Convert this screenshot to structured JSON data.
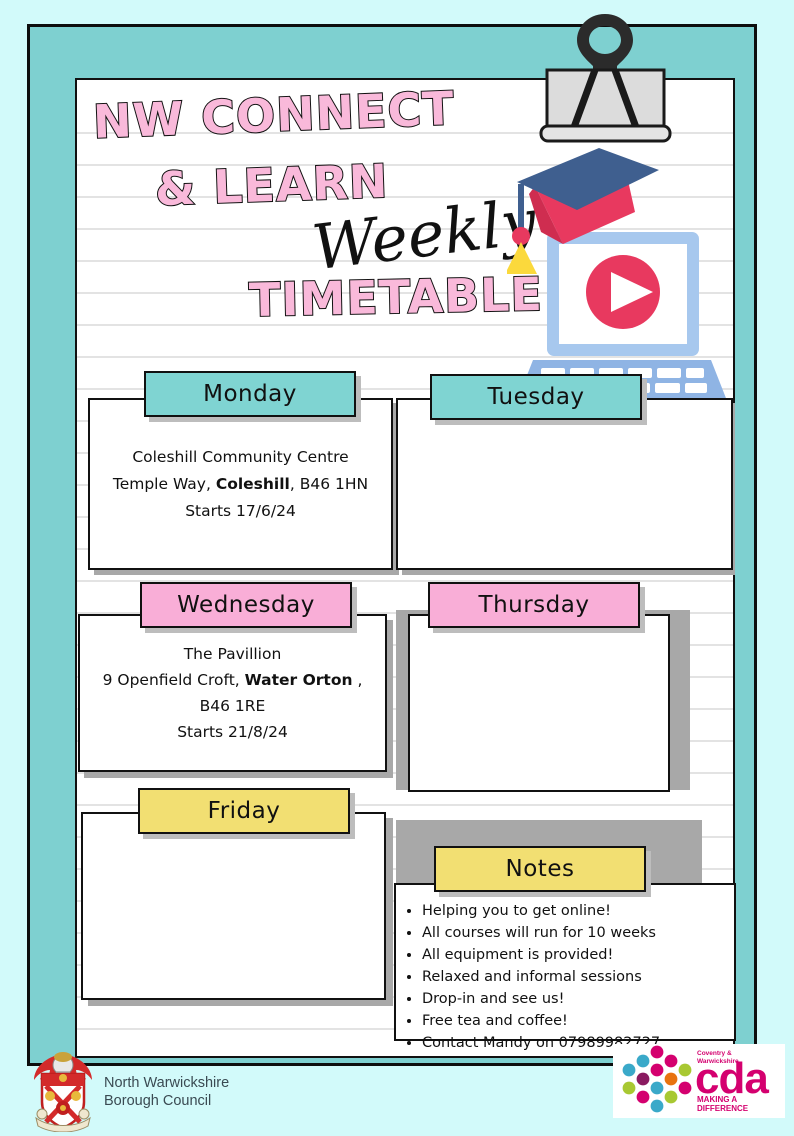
{
  "poster": {
    "title_line1": "NW CONNECT",
    "title_line2": "& LEARN",
    "title_script": "Weekly",
    "title_line3": "TIMETABLE"
  },
  "colors": {
    "page_background": "#d2fafa",
    "frame_teal": "#7ed0d0",
    "header_teal": "#7fd4d2",
    "header_pink": "#f9aed7",
    "header_yellow": "#f2df72",
    "title_pink": "#f9b9da",
    "shadow_gray": "#a8a8a8",
    "accent_crimson": "#e8395f",
    "laptop_blue": "#a7c8ee",
    "cap_navy": "#3f5f8f",
    "cda_magenta": "#d4006f"
  },
  "days": [
    {
      "id": "monday",
      "label": "Monday",
      "color": "teal",
      "lines": [
        {
          "text": "Coleshill Community Centre",
          "bold": ""
        },
        {
          "pre": "Temple Way, ",
          "bold": "Coleshill",
          "post": ", B46 1HN"
        },
        {
          "text": "Starts 17/6/24",
          "bold": ""
        }
      ]
    },
    {
      "id": "tuesday",
      "label": "Tuesday",
      "color": "teal",
      "lines": []
    },
    {
      "id": "wednesday",
      "label": "Wednesday",
      "color": "pink",
      "lines": [
        {
          "text": "The Pavillion",
          "bold": ""
        },
        {
          "pre": "9 Openfield Croft, ",
          "bold": "Water Orton",
          "post": " ,"
        },
        {
          "text": "B46 1RE",
          "bold": ""
        },
        {
          "text": "Starts 21/8/24",
          "bold": ""
        }
      ]
    },
    {
      "id": "thursday",
      "label": "Thursday",
      "color": "pink",
      "lines": []
    },
    {
      "id": "friday",
      "label": "Friday",
      "color": "yellow",
      "lines": []
    }
  ],
  "monday_line1": "Coleshill Community Centre",
  "monday_line2_pre": "Temple Way, ",
  "monday_line2_bold": "Coleshill",
  "monday_line2_post": ", B46 1HN",
  "monday_line3": "Starts 17/6/24",
  "wednesday_line1": "The Pavillion",
  "wednesday_line2_pre": "9 Openfield Croft, ",
  "wednesday_line2_bold": "Water Orton",
  "wednesday_line2_post": " ,",
  "wednesday_line3": "B46 1RE",
  "wednesday_line4": "Starts 21/8/24",
  "notes": {
    "label": "Notes",
    "items": [
      "Helping you to get online!",
      "All courses will run for 10 weeks",
      "All equipment is provided!",
      "Relaxed and informal sessions",
      "Drop-in and see us!",
      "Free tea and coffee!",
      "Contact Mandy on 07989982727"
    ]
  },
  "footer": {
    "council_line1": "North Warwickshire",
    "council_line2": "Borough Council",
    "cda_top_line1": "Coventry &",
    "cda_top_line2": "Warwickshire",
    "cda_main": "cda",
    "cda_tagline": "MAKING A DIFFERENCE"
  }
}
